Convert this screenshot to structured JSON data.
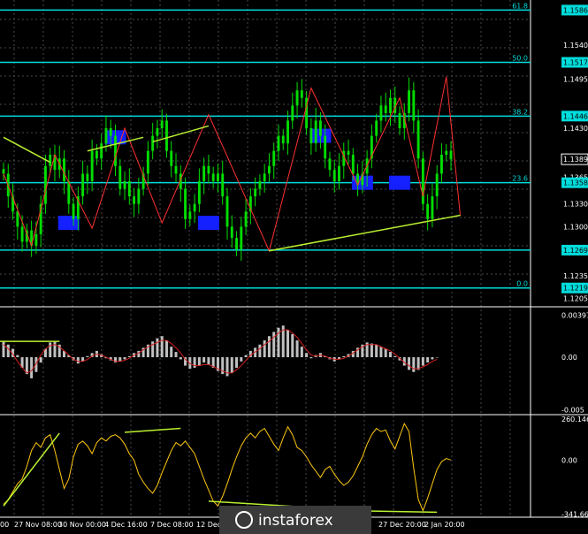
{
  "chart_data": [
    {
      "type": "line",
      "name_shown": "",
      "price_ticks": [
        "1.1586",
        "1.1540",
        "1.1517",
        "1.1495",
        "1.1446",
        "1.1430",
        "1.1389",
        "1.1365",
        "1.1358",
        "1.1330",
        "1.1300",
        "1.1269",
        "1.1235",
        "1.1219",
        "1.1205"
      ],
      "ylim": [
        1.12,
        1.159
      ],
      "fib_levels": [
        {
          "label": "61.8",
          "value": 1.1586
        },
        {
          "label": "50.0",
          "value": 1.1517
        },
        {
          "label": "38.2",
          "value": 1.1446
        },
        {
          "label": "23.6",
          "value": 1.1358
        },
        {
          "label": "",
          "value": 1.1269
        },
        {
          "label": "0.0",
          "value": 1.1219
        }
      ],
      "current_price": "1.1389",
      "close_series": [
        1.137,
        1.134,
        1.132,
        1.13,
        1.128,
        1.1295,
        1.1275,
        1.129,
        1.133,
        1.138,
        1.1395,
        1.1375,
        1.139,
        1.136,
        1.133,
        1.131,
        1.134,
        1.137,
        1.136,
        1.14,
        1.139,
        1.141,
        1.143,
        1.142,
        1.138,
        1.135,
        1.136,
        1.134,
        1.133,
        1.135,
        1.137,
        1.14,
        1.142,
        1.143,
        1.144,
        1.14,
        1.138,
        1.137,
        1.135,
        1.131,
        1.132,
        1.133,
        1.136,
        1.138,
        1.137,
        1.136,
        1.137,
        1.134,
        1.13,
        1.1285,
        1.127,
        1.13,
        1.132,
        1.134,
        1.135,
        1.136,
        1.137,
        1.138,
        1.14,
        1.142,
        1.141,
        1.144,
        1.146,
        1.148,
        1.147,
        1.143,
        1.141,
        1.144,
        1.142,
        1.139,
        1.1375,
        1.136,
        1.138,
        1.14,
        1.1395,
        1.137,
        1.1355,
        1.137,
        1.139,
        1.142,
        1.144,
        1.146,
        1.145,
        1.147,
        1.145,
        1.143,
        1.145,
        1.148,
        1.144,
        1.139,
        1.133,
        1.131,
        1.134,
        1.137,
        1.1395,
        1.14,
        1.1389
      ],
      "zigzag": [
        [
          0,
          1.137
        ],
        [
          6,
          1.1275
        ],
        [
          11,
          1.1395
        ],
        [
          19,
          1.1298
        ],
        [
          26,
          1.143
        ],
        [
          34,
          1.1305
        ],
        [
          44,
          1.1448
        ],
        [
          57,
          1.1268
        ],
        [
          66,
          1.1483
        ],
        [
          76,
          1.1355
        ],
        [
          85,
          1.147
        ],
        [
          90,
          1.134
        ],
        [
          95,
          1.1498
        ],
        [
          98,
          1.1315
        ]
      ],
      "support_line": [
        [
          57,
          1.1268
        ],
        [
          98,
          1.1315
        ]
      ],
      "resistance_lines": [
        [
          [
            0,
            1.1418
          ],
          [
            10,
            1.1385
          ]
        ],
        [
          [
            18,
            1.14
          ],
          [
            30,
            1.1418
          ]
        ],
        [
          [
            32,
            1.1412
          ],
          [
            44,
            1.1433
          ]
        ]
      ]
    },
    {
      "type": "bar",
      "indicator": "MACD",
      "ticks": [
        "0.00397",
        "0.00",
        "-0.005"
      ],
      "ylim": [
        -0.0052,
        0.0042
      ],
      "histogram": [
        0.0015,
        0.0012,
        0.0008,
        0.0002,
        -0.001,
        -0.0016,
        -0.002,
        -0.0014,
        -0.0005,
        0.0008,
        0.0014,
        0.0015,
        0.0012,
        0.0006,
        0.0002,
        -0.0003,
        -0.0006,
        -0.0004,
        0.0001,
        0.0004,
        0.0006,
        0.0003,
        -0.0001,
        -0.0003,
        -0.0005,
        -0.0004,
        -0.0002,
        0.0001,
        0.0004,
        0.0006,
        0.0009,
        0.0012,
        0.0015,
        0.0018,
        0.002,
        0.0016,
        0.001,
        0.0005,
        -0.0002,
        -0.0008,
        -0.0011,
        -0.001,
        -0.0008,
        -0.0005,
        -0.0007,
        -0.001,
        -0.0013,
        -0.0016,
        -0.0018,
        -0.0015,
        -0.001,
        -0.0004,
        0.0002,
        0.0006,
        0.0009,
        0.0012,
        0.0016,
        0.002,
        0.0024,
        0.0028,
        0.003,
        0.0026,
        0.0022,
        0.0016,
        0.001,
        0.0004,
        -0.0001,
        0.0002,
        0.0004,
        0.0001,
        -0.0002,
        -0.0004,
        -0.0002,
        0.0001,
        0.0003,
        0.0006,
        0.0009,
        0.0012,
        0.0014,
        0.0013,
        0.0012,
        0.001,
        0.0008,
        0.0005,
        0.0001,
        -0.0003,
        -0.0008,
        -0.0012,
        -0.0014,
        -0.0012,
        -0.0008,
        -0.0005,
        -0.0002,
        0.0
      ],
      "signal": [
        0.0012,
        0.0008,
        0.0003,
        -0.0004,
        -0.001,
        -0.0015,
        -0.0013,
        -0.0006,
        0.0002,
        0.0008,
        0.0011,
        0.0012,
        0.001,
        0.0006,
        0.0002,
        -0.0002,
        -0.0004,
        -0.0004,
        -0.0002,
        0.0001,
        0.0003,
        0.0002,
        0.0,
        -0.0002,
        -0.0004,
        -0.0004,
        -0.0003,
        -0.0001,
        0.0002,
        0.0004,
        0.0007,
        0.001,
        0.0012,
        0.0014,
        0.0016,
        0.0016,
        0.0013,
        0.0009,
        0.0004,
        -0.0002,
        -0.0006,
        -0.0008,
        -0.0008,
        -0.0007,
        -0.0007,
        -0.0009,
        -0.0011,
        -0.0013,
        -0.0015,
        -0.0015,
        -0.0012,
        -0.0008,
        -0.0003,
        0.0002,
        0.0005,
        0.0008,
        0.0012,
        0.0015,
        0.0019,
        0.0023,
        0.0026,
        0.0026,
        0.0023,
        0.0019,
        0.0013,
        0.0007,
        0.0002,
        0.0001,
        0.0002,
        0.0001,
        -0.0001,
        -0.0002,
        -0.0002,
        -0.0001,
        0.0001,
        0.0004,
        0.0007,
        0.001,
        0.0012,
        0.0012,
        0.0012,
        0.001,
        0.0008,
        0.0006,
        0.0003,
        -0.0001,
        -0.0005,
        -0.0008,
        -0.0011,
        -0.0011,
        -0.0009,
        -0.0007,
        -0.0004,
        -0.0002
      ]
    },
    {
      "type": "line",
      "indicator": "CCI",
      "ticks": [
        "260.1469",
        "0.00",
        "-341.662"
      ],
      "ylim": [
        -350,
        270
      ],
      "values": [
        -280,
        -250,
        -200,
        -150,
        -120,
        -40,
        60,
        110,
        80,
        140,
        160,
        60,
        -60,
        -180,
        -120,
        20,
        100,
        120,
        90,
        40,
        110,
        140,
        120,
        150,
        160,
        140,
        100,
        40,
        0,
        -90,
        -140,
        -180,
        -210,
        -160,
        -80,
        -10,
        60,
        110,
        90,
        120,
        80,
        40,
        -40,
        -120,
        -190,
        -260,
        -290,
        -230,
        -150,
        -60,
        20,
        90,
        140,
        170,
        140,
        180,
        200,
        150,
        100,
        60,
        140,
        210,
        160,
        80,
        60,
        20,
        -30,
        -70,
        -110,
        -60,
        -40,
        -90,
        -130,
        -160,
        -140,
        -100,
        -40,
        20,
        100,
        160,
        200,
        180,
        190,
        120,
        70,
        150,
        230,
        180,
        -50,
        -250,
        -320,
        -240,
        -150,
        -60,
        -10,
        10,
        0
      ],
      "trend_lines": [
        [
          [
            0,
            -290
          ],
          [
            12,
            170
          ]
        ],
        [
          [
            26,
            175
          ],
          [
            38,
            200
          ]
        ],
        [
          [
            44,
            -260
          ],
          [
            66,
            -300
          ]
        ],
        [
          [
            74,
            -320
          ],
          [
            93,
            -330
          ]
        ]
      ]
    }
  ],
  "time_labels": [
    "00",
    "27 Nov 08:00",
    "30 Nov 00:00",
    "4 Dec 16:00",
    "7 Dec 08:00",
    "12 Dec",
    "27 Dec 20:00",
    "2 Jan 20:00"
  ],
  "watermark": "instaforex",
  "colors": {
    "background": "#000000",
    "grid": "#4a4a4a",
    "fib": "#00dcdc",
    "candle": "#00dd00",
    "zigzag": "#ff3030",
    "trendline": "#b9f030",
    "box": "#1420ff",
    "macd_hist": "#c0c0c0",
    "macd_signal": "#d42020",
    "cci": "#ffc810",
    "axis_text": "#ffffff"
  }
}
